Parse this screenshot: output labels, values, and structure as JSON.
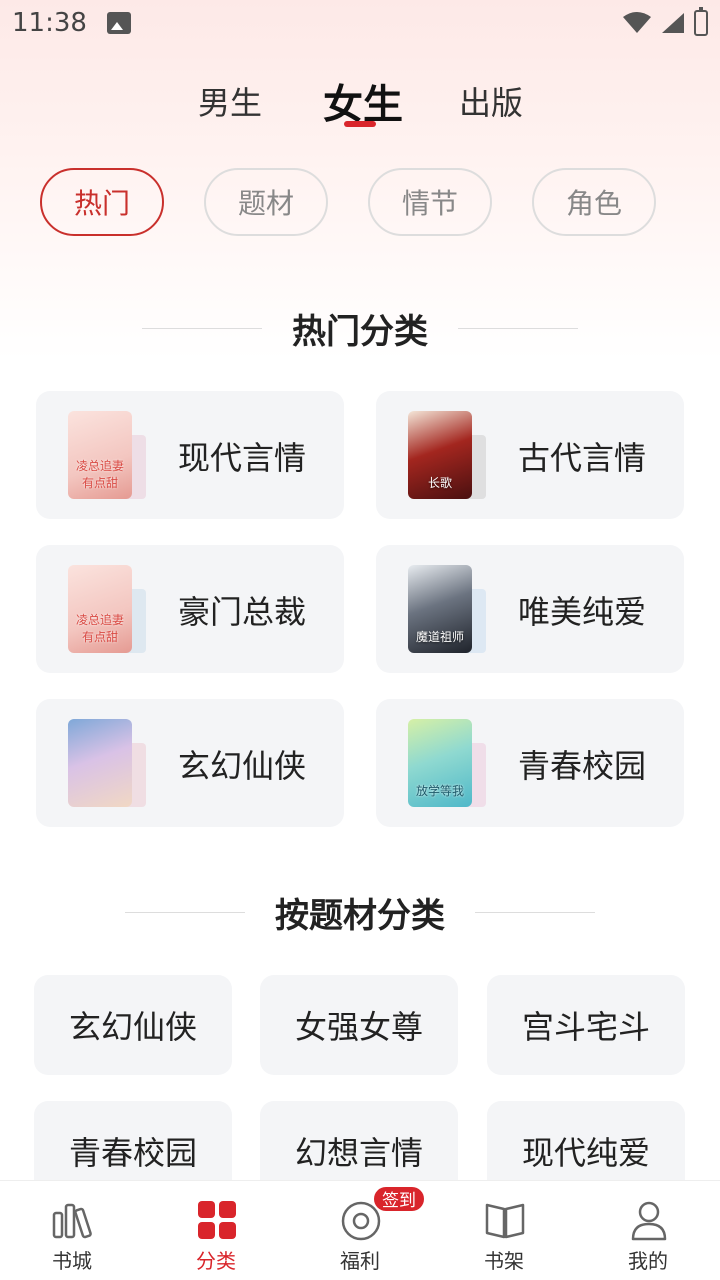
{
  "status_bar": {
    "time": "11:38"
  },
  "gender_tabs": {
    "male": "男生",
    "female": "女生",
    "publish": "出版",
    "active": "female"
  },
  "filter_chips": [
    "热门",
    "题材",
    "情节",
    "角色"
  ],
  "hot_section": {
    "title": "热门分类",
    "items": [
      {
        "label": "现代言情",
        "cover_text": "凌总追妻有点甜",
        "cover_color": "#f3c6c0",
        "accent": "#d94a43"
      },
      {
        "label": "古代言情",
        "cover_text": "长歌",
        "cover_color": "#7a1c1c",
        "accent": "#c23b2e"
      },
      {
        "label": "豪门总裁",
        "cover_text": "凌总追妻有点甜",
        "cover_color": "#f3c6c0",
        "accent": "#d94a43"
      },
      {
        "label": "唯美纯爱",
        "cover_text": "魔道祖师",
        "cover_color": "#3a3f4a",
        "accent": "#9bb8d3"
      },
      {
        "label": "玄幻仙侠",
        "cover_text": "",
        "cover_color": "#c9c4e8",
        "accent": "#e9b7c5"
      },
      {
        "label": "青春校园",
        "cover_text": "放学等我",
        "cover_color": "#8fd9d0",
        "accent": "#8fc7e8"
      }
    ]
  },
  "theme_section": {
    "title": "按题材分类",
    "items": [
      "玄幻仙侠",
      "女强女尊",
      "宫斗宅斗",
      "青春校园",
      "幻想言情",
      "现代纯爱"
    ]
  },
  "bottom_nav": {
    "items": [
      {
        "label": "书城",
        "icon": "books-icon"
      },
      {
        "label": "分类",
        "icon": "category-grid-icon"
      },
      {
        "label": "福利",
        "icon": "welfare-icon"
      },
      {
        "label": "书架",
        "icon": "bookshelf-icon"
      },
      {
        "label": "我的",
        "icon": "profile-icon"
      }
    ],
    "active": "分类",
    "badge": "签到"
  },
  "colors": {
    "accent": "#d9252b",
    "card_bg": "#f4f5f7"
  }
}
